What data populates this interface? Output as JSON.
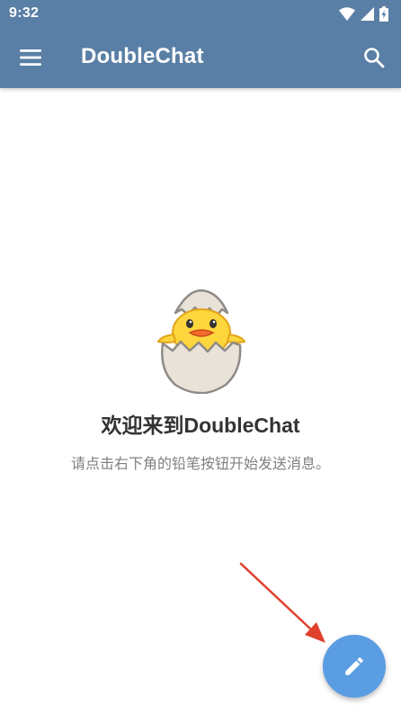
{
  "status_bar": {
    "time": "9:32",
    "icons": [
      "wifi-icon",
      "signal-icon",
      "battery-charging-icon"
    ]
  },
  "app_bar": {
    "menu_icon": "hamburger-menu-icon",
    "title": "DoubleChat",
    "search_icon": "search-icon"
  },
  "empty_state": {
    "image": "hatching-chick-icon",
    "title": "欢迎来到DoubleChat",
    "hint": "请点击右下角的铅笔按钮开始发送消息。"
  },
  "fab": {
    "icon": "pencil-icon"
  },
  "annotation": {
    "type": "red-arrow",
    "points_to": "compose-fab"
  },
  "colors": {
    "app_bar": "#5a7fa6",
    "fab": "#5b9de2",
    "title_text": "#333333",
    "hint_text": "#808080",
    "arrow": "#e0402c"
  }
}
